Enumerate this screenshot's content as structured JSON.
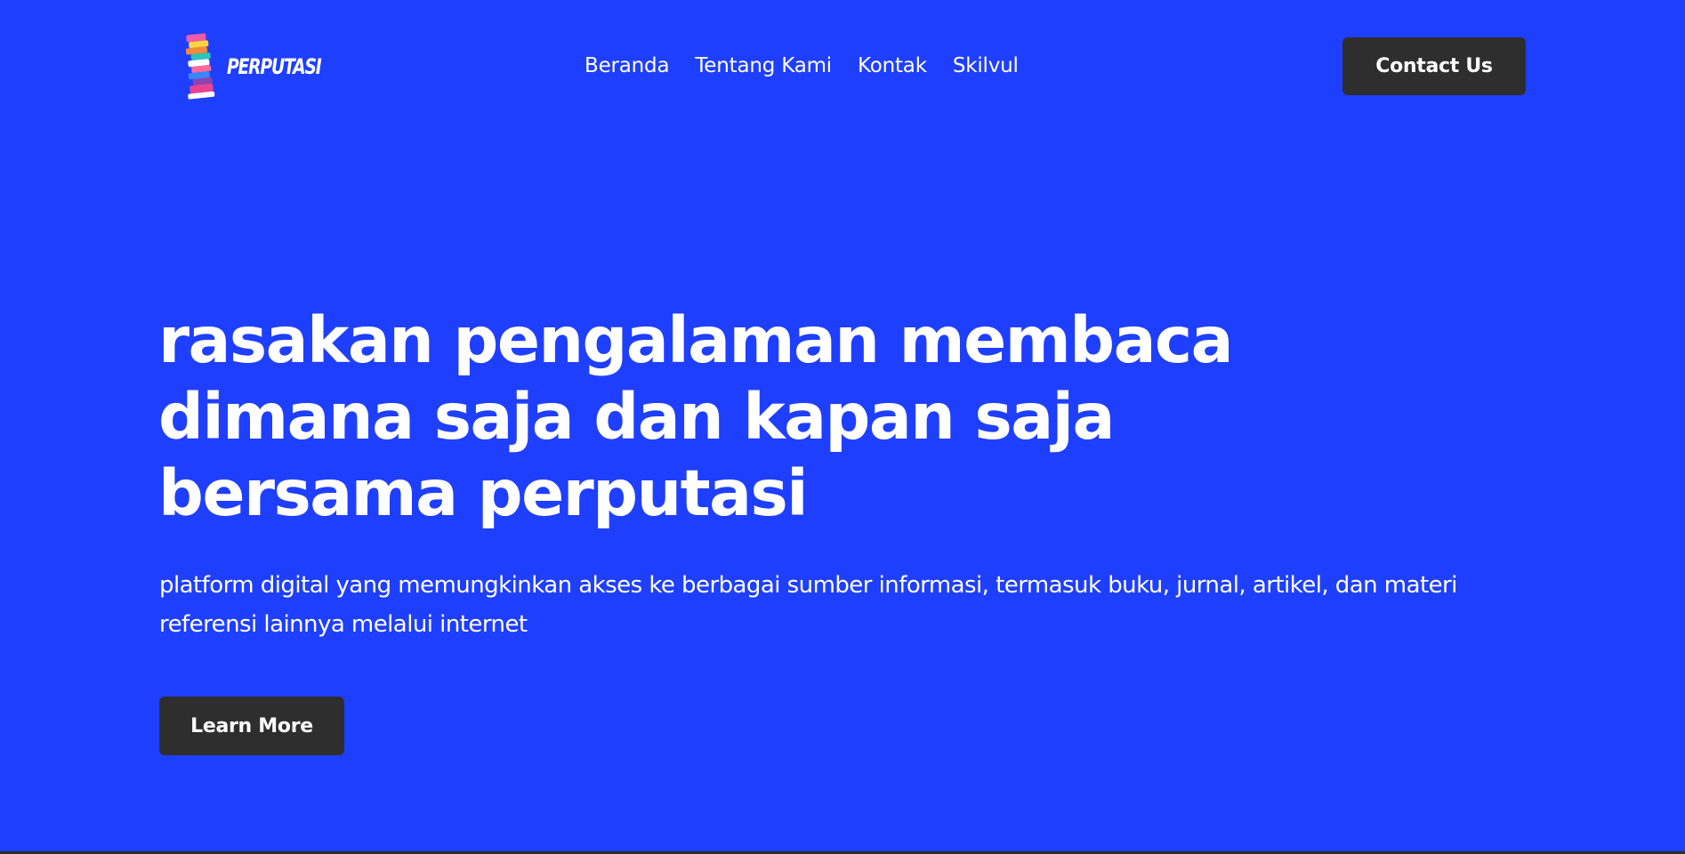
{
  "colors": {
    "background": "#1f3ffe",
    "button": "#2e2e2e",
    "text": "#ffffff"
  },
  "header": {
    "logo": {
      "icon": "book-stack-icon",
      "text": "PERPUTASI"
    },
    "nav": [
      {
        "label": "Beranda"
      },
      {
        "label": "Tentang Kami"
      },
      {
        "label": "Kontak"
      },
      {
        "label": "Skilvul"
      }
    ],
    "contact_label": "Contact Us"
  },
  "hero": {
    "title_lines": [
      "rasakan pengalaman membaca",
      "dimana saja dan kapan saja",
      "bersama perputasi"
    ],
    "subtitle": "platform digital yang memungkinkan akses ke berbagai sumber informasi, termasuk buku, jurnal, artikel, dan materi referensi lainnya melalui internet",
    "cta_label": "Learn More"
  }
}
